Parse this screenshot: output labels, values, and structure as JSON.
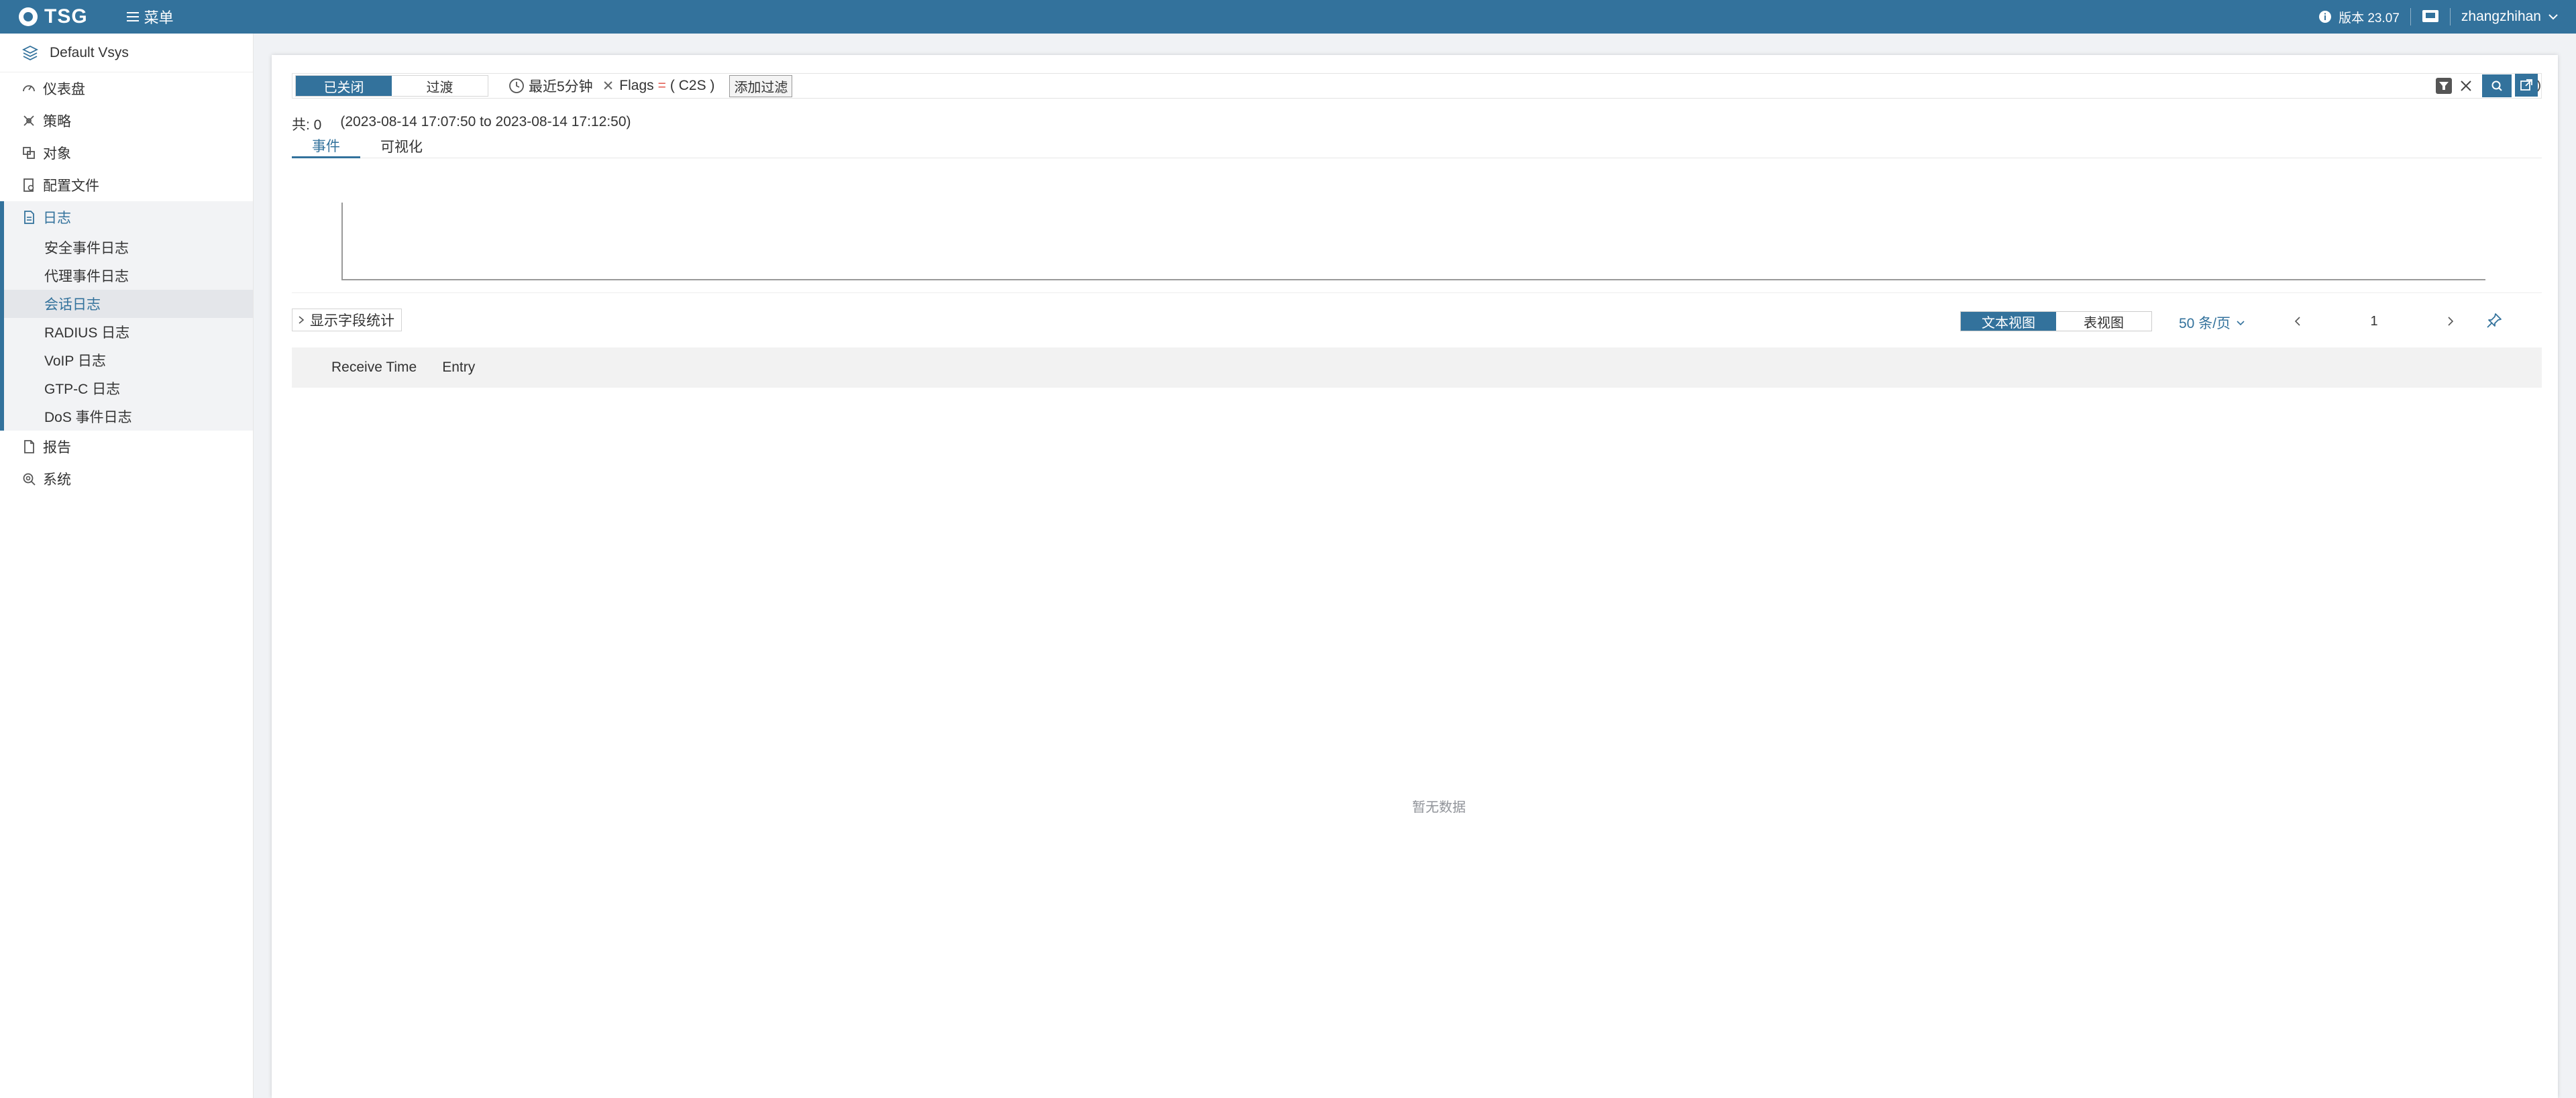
{
  "topbar": {
    "logo_text": "TSG",
    "menu_label": "菜单",
    "version": "版本 23.07",
    "username": "zhangzhihan"
  },
  "sidebar": {
    "vsys": "Default Vsys",
    "items": [
      {
        "label": "仪表盘",
        "icon": "dashboard-icon"
      },
      {
        "label": "策略",
        "icon": "policy-icon"
      },
      {
        "label": "对象",
        "icon": "objects-icon"
      },
      {
        "label": "配置文件",
        "icon": "profile-icon"
      },
      {
        "label": "日志",
        "icon": "log-icon"
      },
      {
        "label": "报告",
        "icon": "report-icon"
      },
      {
        "label": "系统",
        "icon": "system-icon"
      }
    ],
    "log_subitems": [
      "安全事件日志",
      "代理事件日志",
      "会话日志",
      "RADIUS 日志",
      "VoIP 日志",
      "GTP-C 日志",
      "DoS 事件日志"
    ],
    "active_subitem": "会话日志"
  },
  "filter": {
    "toggle_closed": "已关闭",
    "toggle_transition": "过渡",
    "time_range": "最近5分钟",
    "chip_field": "Flags",
    "chip_operator": "=",
    "chip_value": "( C2S )",
    "add_filter": "添加过滤"
  },
  "summary": {
    "count": "共: 0",
    "range": "(2023-08-14 17:07:50 to 2023-08-14 17:12:50)"
  },
  "tabs": [
    "事件",
    "可视化"
  ],
  "toolbar": {
    "field_stats": "显示字段统计",
    "text_view": "文本视图",
    "table_view": "表视图",
    "page_size": "50 条/页",
    "page": "1"
  },
  "table": {
    "columns": [
      "Receive Time",
      "Entry"
    ],
    "empty_text": "暂无数据"
  },
  "colors": {
    "primary": "#33729c",
    "operator": "#e2574c"
  }
}
